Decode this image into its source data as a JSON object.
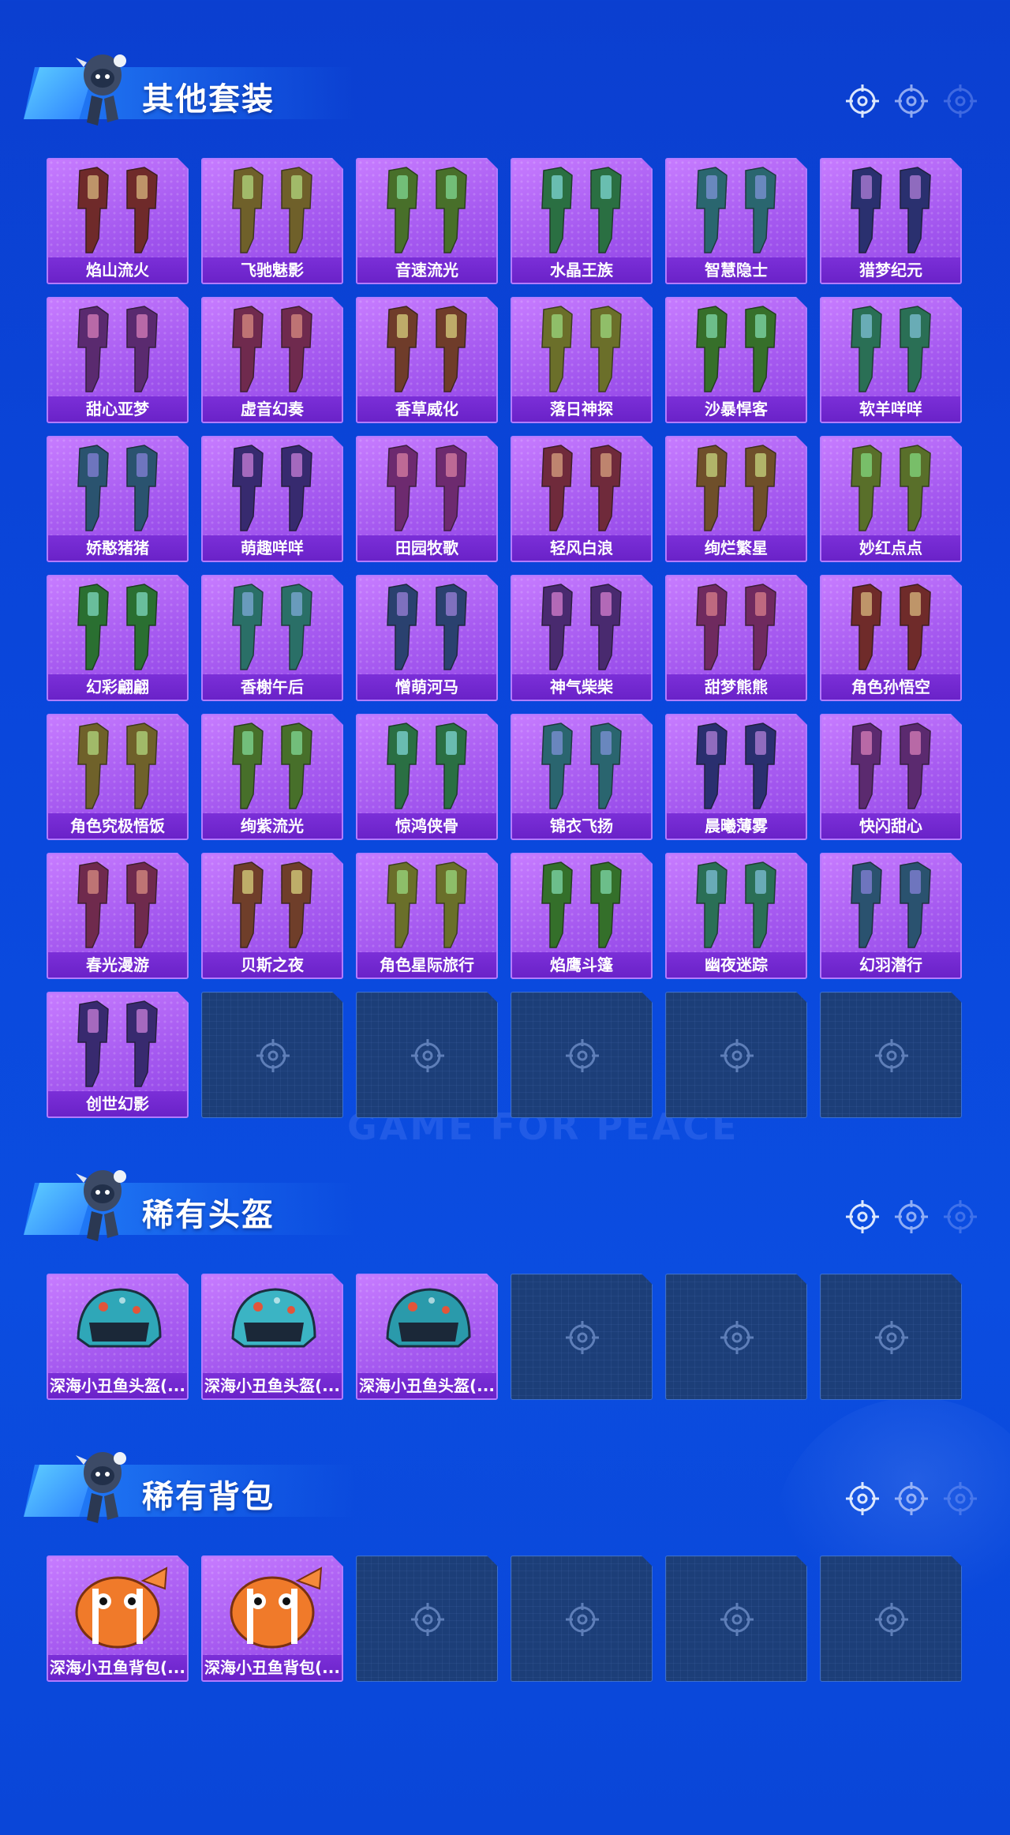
{
  "colors": {
    "background": "#0b45d8",
    "card": "#a65af0",
    "card_label": "#6a22c8",
    "empty_slot": "#1c3e78"
  },
  "watermark": "GAME FOR PEACE",
  "sections": [
    {
      "title": "其他套装",
      "items": [
        "焰山流火",
        "飞驰魅影",
        "音速流光",
        "水晶王族",
        "智慧隐士",
        "猎梦纪元",
        "甜心亚梦",
        "虚音幻奏",
        "香草威化",
        "落日神探",
        "沙暴悍客",
        "软羊咩咩",
        "娇憨猪猪",
        "萌趣咩咩",
        "田园牧歌",
        "轻风白浪",
        "绚烂繁星",
        "妙红点点",
        "幻彩翩翩",
        "香榭午后",
        "憎萌河马",
        "神气柴柴",
        "甜梦熊熊",
        "角色孙悟空",
        "角色究极悟饭",
        "绚紫流光",
        "惊鸿侠骨",
        "锦衣飞扬",
        "晨曦薄雾",
        "快闪甜心",
        "春光漫游",
        "贝斯之夜",
        "角色星际旅行",
        "焰鹰斗篷",
        "幽夜迷踪",
        "幻羽潜行",
        "创世幻影"
      ],
      "empty_slots": 5
    },
    {
      "title": "稀有头盔",
      "items": [
        "深海小丑鱼头盔(...",
        "深海小丑鱼头盔(...",
        "深海小丑鱼头盔(..."
      ],
      "empty_slots": 3
    },
    {
      "title": "稀有背包",
      "items": [
        "深海小丑鱼背包(...",
        "深海小丑鱼背包(..."
      ],
      "empty_slots": 4
    }
  ]
}
